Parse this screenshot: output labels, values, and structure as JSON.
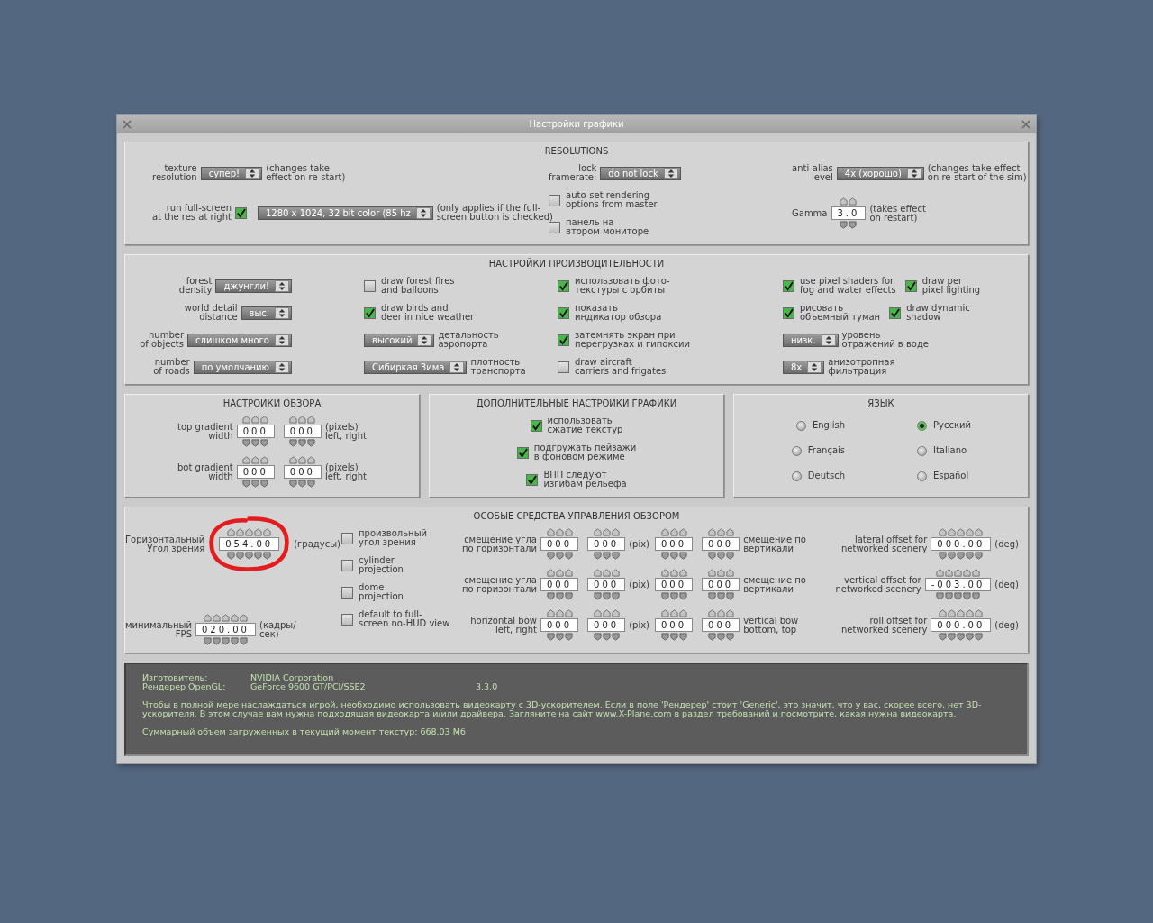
{
  "window": {
    "title": "Настройки графики"
  },
  "panels": [
    {
      "title": "RESOLUTIONS",
      "columns": [
        [
          [
            {
              "kind": "dropdown",
              "label": "texture\nresolution",
              "value": "супер!",
              "note": "(changes take\neffect on re-start)"
            }
          ],
          [
            {
              "kind": "checkbox-left",
              "label": "run full-screen\nat the res at right",
              "checked": true
            },
            {
              "kind": "dropdown",
              "value": "1280 x 1024, 32 bit color (85 hz",
              "note": "(only applies if the full-\nscreen button is checked)"
            }
          ]
        ],
        [
          [
            {
              "kind": "dropdown",
              "label": "lock\nframerate:",
              "value": "do not lock"
            }
          ],
          [
            {
              "kind": "checkbox",
              "label": "auto-set rendering\noptions from master",
              "checked": false
            }
          ],
          [
            {
              "kind": "checkbox",
              "label": "панель на\nвтором мониторе",
              "checked": false
            }
          ]
        ],
        [
          [
            {
              "kind": "dropdown",
              "label": "anti-alias\nlevel",
              "value": "4x (хорошо)",
              "note": "(changes take effect\non re-start of the sim)"
            }
          ],
          [
            {
              "kind": "spinner",
              "label": "Gamma",
              "value": "3.0",
              "note": "(takes effect\non restart)"
            }
          ]
        ]
      ]
    },
    {
      "title": "НАСТРОЙКИ ПРОИЗВОДИТЕЛЬНОСТИ",
      "columns": [
        [
          [
            {
              "kind": "dropdown",
              "label": "forest\ndensity",
              "value": "джунгли!"
            }
          ],
          [
            {
              "kind": "dropdown",
              "label": "world detail\ndistance",
              "value": "выс."
            }
          ],
          [
            {
              "kind": "dropdown",
              "label": "number\nof objects",
              "value": "слишком много"
            }
          ],
          [
            {
              "kind": "dropdown",
              "label": "number\nof roads",
              "value": "по умолчанию"
            }
          ]
        ],
        [
          [
            {
              "kind": "checkbox",
              "label": "draw forest fires\nand balloons",
              "checked": false
            }
          ],
          [
            {
              "kind": "checkbox",
              "label": "draw birds and\ndeer in nice weather",
              "checked": true
            }
          ],
          [
            {
              "kind": "dropdown",
              "value": "высокий",
              "note": "детальность\nаэропорта"
            }
          ],
          [
            {
              "kind": "dropdown",
              "value": "Сибиркая Зима",
              "note": "плотность\nтранспорта"
            }
          ]
        ],
        [
          [
            {
              "kind": "checkbox",
              "label": "использовать фото-\nтекстуры с орбиты",
              "checked": true
            }
          ],
          [
            {
              "kind": "checkbox",
              "label": "показать\nиндикатор обзора",
              "checked": true
            }
          ],
          [
            {
              "kind": "checkbox",
              "label": "затемнять экран при\nперегрузках и гипоксии",
              "checked": true
            }
          ],
          [
            {
              "kind": "checkbox",
              "label": "draw aircraft\ncarriers and frigates",
              "checked": false
            }
          ]
        ],
        [
          [
            {
              "kind": "checkbox",
              "label": "use pixel shaders for\nfog and water effects",
              "checked": true
            },
            {
              "kind": "checkbox",
              "label": "draw per\npixel lighting",
              "checked": true
            }
          ],
          [
            {
              "kind": "checkbox",
              "label": "рисовать\nобъемный туман",
              "checked": true
            },
            {
              "kind": "checkbox",
              "label": "draw dynamic\nshadow",
              "checked": true
            }
          ],
          [
            {
              "kind": "dropdown",
              "value": "низк.",
              "note": "уровень\nотражений в воде"
            }
          ],
          [
            {
              "kind": "dropdown",
              "value": "8x",
              "note": "анизотропная\nфильтрация"
            }
          ]
        ]
      ]
    },
    {
      "title": "НАСТРОЙКИ ОБЗОРА",
      "columns": [
        [
          [
            {
              "kind": "spinner",
              "label": "top gradient\nwidth",
              "value": "000"
            },
            {
              "kind": "spinner",
              "value": "000",
              "note": "(pixels)\nleft, right"
            }
          ],
          [
            {
              "kind": "spinner",
              "label": "bot gradient\nwidth",
              "value": "000"
            },
            {
              "kind": "spinner",
              "value": "000",
              "note": "(pixels)\nleft, right"
            }
          ]
        ]
      ]
    },
    {
      "title": "ДОПОЛНИТЕЛЬНЫЕ НАСТРОЙКИ ГРАФИКИ",
      "columns": [
        [
          [
            {
              "kind": "checkbox",
              "label": "использовать\nсжатие текстур",
              "checked": true
            }
          ],
          [
            {
              "kind": "checkbox",
              "label": "подгружать пейзажи\nв фоновом режиме",
              "checked": true
            }
          ],
          [
            {
              "kind": "checkbox",
              "label": "ВПП следуют\nизгибам рельефа",
              "checked": true
            }
          ]
        ]
      ]
    },
    {
      "title": "ЯЗЫК",
      "columns": [
        [
          [
            {
              "kind": "radio",
              "label": "English",
              "selected": false
            }
          ],
          [
            {
              "kind": "radio",
              "label": "Français",
              "selected": false
            }
          ],
          [
            {
              "kind": "radio",
              "label": "Deutsch",
              "selected": false
            }
          ]
        ],
        [
          [
            {
              "kind": "radio",
              "label": "Русский",
              "selected": true
            }
          ],
          [
            {
              "kind": "radio",
              "label": "Italiano",
              "selected": false
            }
          ],
          [
            {
              "kind": "radio",
              "label": "Español",
              "selected": false
            }
          ]
        ]
      ]
    },
    {
      "title": "ОСОБЫЕ СРЕДСТВА УПРАВЛЕНИЯ ОБЗОРОМ",
      "columns": [
        [
          [
            {
              "kind": "spinner",
              "label": "Горизонтальный\nУгол зрения",
              "value": "054.00",
              "note": "(градусы)"
            }
          ],
          [
            {
              "kind": "spinner",
              "label": "минимальный\nFPS",
              "value": "020.00",
              "note": "(кадры/\nсек)"
            }
          ]
        ],
        [
          [
            {
              "kind": "checkbox",
              "label": "произвольный\nугол зрения",
              "checked": false
            }
          ],
          [
            {
              "kind": "checkbox",
              "label": "cylinder\nprojection",
              "checked": false
            }
          ],
          [
            {
              "kind": "checkbox",
              "label": "dome\nprojection",
              "checked": false
            }
          ],
          [
            {
              "kind": "checkbox",
              "label": "default to full-\nscreen no-HUD view",
              "checked": false
            }
          ]
        ],
        [
          [
            {
              "kind": "spinner",
              "label": "смещение угла\nпо горизонтали",
              "value": "000"
            },
            {
              "kind": "spinner",
              "value": "000",
              "note": "(pix)"
            }
          ],
          [
            {
              "kind": "spinner",
              "label": "смещение угла\nпо горизонтали",
              "value": "000"
            },
            {
              "kind": "spinner",
              "value": "000",
              "note": "(pix)"
            }
          ],
          [
            {
              "kind": "spinner",
              "label": "horizontal bow\nleft, right",
              "value": "000"
            },
            {
              "kind": "spinner",
              "value": "000",
              "note": "(pix)"
            }
          ]
        ],
        [
          [
            {
              "kind": "spinner",
              "value": "000"
            },
            {
              "kind": "spinner",
              "value": "000",
              "note": "смещение по\nвертикали"
            }
          ],
          [
            {
              "kind": "spinner",
              "value": "000"
            },
            {
              "kind": "spinner",
              "value": "000",
              "note": "смещение по\nвертикали"
            }
          ],
          [
            {
              "kind": "spinner",
              "value": "000"
            },
            {
              "kind": "spinner",
              "value": "000",
              "note": "vertical bow\nbottom, top"
            }
          ]
        ],
        [
          [
            {
              "kind": "spinner",
              "label": "lateral offset for\nnetworked scenery",
              "value": "000.00",
              "note": "(deg)"
            }
          ],
          [
            {
              "kind": "spinner",
              "label": "vertical offset for\nnetworked scenery",
              "value": "-003.00",
              "note": "(deg)"
            }
          ],
          [
            {
              "kind": "spinner",
              "label": "roll offset for\nnetworked scenery",
              "value": "000.00",
              "note": "(deg)"
            }
          ]
        ]
      ]
    }
  ],
  "info": {
    "rows": [
      {
        "label": "Изготовитель:",
        "value": "NVIDIA Corporation"
      },
      {
        "label": "Рендерер OpenGL:",
        "value": "GeForce 9600 GT/PCI/SSE2",
        "version": "3.3.0"
      }
    ],
    "message": "Чтобы в полной мере наслаждаться игрой, необходимо использовать видеокарту с 3D-ускорителем. Если в поле 'Рендерер' стоит 'Generic', это значит, что у вас, скорее всего, нет 3D-ускорителя. В этом случае вам нужна подходящая видеокарта и/или драйвера. Загляните на сайт www.X-Plane.com в раздел требований и посмотрите, какая нужна видеокарта.",
    "total": "Суммарный объем загруженных в текущий момент текстур: 668.03 Мб"
  }
}
